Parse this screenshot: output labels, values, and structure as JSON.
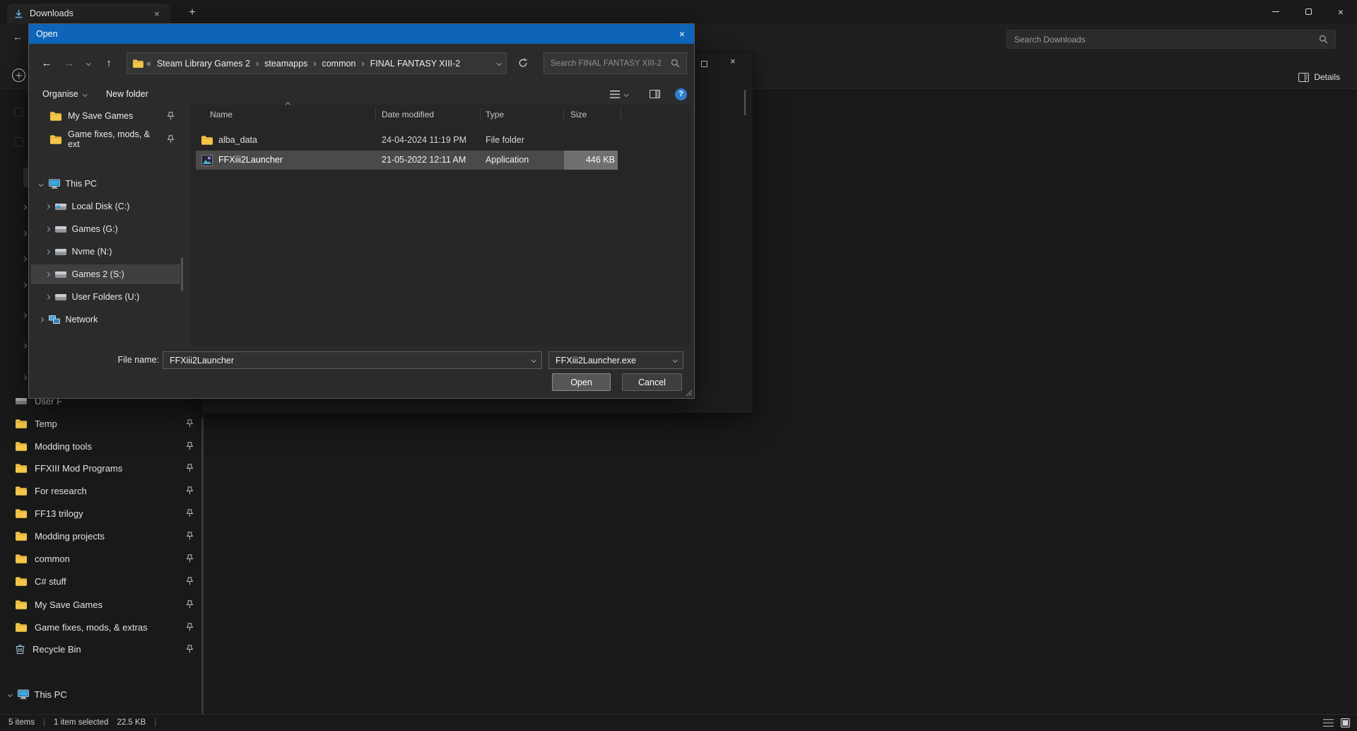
{
  "colors": {
    "dialog_titlebar": "#0e64b8",
    "selection_highlight": "#4a4a4a",
    "folder_yellow": "#f3c64a",
    "download_icon_blue": "#6cb4ec"
  },
  "icons": {
    "close": "×",
    "back_arrow": "←",
    "forward_arrow": "→",
    "up_arrow": "↑",
    "overflow_chevrons": "«",
    "breadcrumb_separator": "›",
    "new_tab": "+",
    "help": "?"
  },
  "explorer": {
    "tab_title": "Downloads",
    "search_placeholder": "Search Downloads",
    "details_button_label": "Details",
    "sidebar": {
      "clipped_item_label": "User F",
      "pinned_items": [
        "Temp",
        "Modding tools",
        "FFXIII Mod Programs",
        "For research",
        "FF13 trilogy",
        "Modding projects",
        "common",
        "C# stuff",
        "My Save Games",
        "Game fixes, mods, & extras",
        "Recycle Bin"
      ],
      "this_pc_label": "This PC"
    },
    "status_bar": {
      "item_count": "5 items",
      "separator": "|",
      "selection_text": "1 item selected",
      "selection_size": "22.5 KB"
    }
  },
  "dialog": {
    "title": "Open",
    "breadcrumb": {
      "segments": [
        "Steam Library Games 2",
        "steamapps",
        "common",
        "FINAL FANTASY XIII-2"
      ]
    },
    "search_placeholder": "Search FINAL FANTASY XIII-2",
    "toolbar": {
      "organise_label": "Organise",
      "new_folder_label": "New folder"
    },
    "tree": [
      {
        "label": "My Save Games",
        "icon": "folder",
        "pinned": true
      },
      {
        "label": "Game fixes, mods, & ext",
        "icon": "folder",
        "pinned": true
      },
      {
        "label": "This PC",
        "icon": "this-pc",
        "expanded": true
      },
      {
        "label": "Local Disk (C:)",
        "icon": "windows-drive"
      },
      {
        "label": "Games (G:)",
        "icon": "drive"
      },
      {
        "label": "Nvme (N:)",
        "icon": "drive"
      },
      {
        "label": "Games 2 (S:)",
        "icon": "drive",
        "selected": true
      },
      {
        "label": "User Folders (U:)",
        "icon": "drive"
      },
      {
        "label": "Network",
        "icon": "network"
      }
    ],
    "file_list": {
      "columns": [
        "Name",
        "Date modified",
        "Type",
        "Size"
      ],
      "sort_column": "Name",
      "rows": [
        {
          "name": "alba_data",
          "date_modified": "24-04-2024 11:19 PM",
          "type": "File folder",
          "size": "",
          "icon": "folder"
        },
        {
          "name": "FFXiii2Launcher",
          "date_modified": "21-05-2022 12:11 AM",
          "type": "Application",
          "size": "446 KB",
          "icon": "application",
          "selected": true
        }
      ]
    },
    "file_name_label": "File name:",
    "file_name_value": "FFXiii2Launcher",
    "file_type_value": "FFXiii2Launcher.exe",
    "open_button_label": "Open",
    "cancel_button_label": "Cancel"
  }
}
